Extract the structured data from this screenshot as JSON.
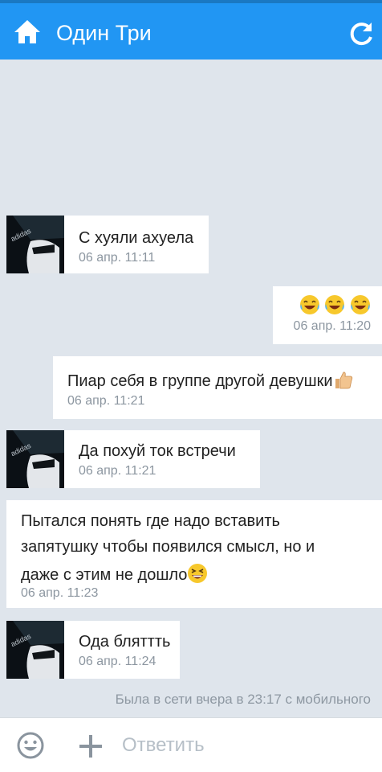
{
  "header": {
    "title": "Один Три",
    "home_icon": "home-icon",
    "refresh_icon": "refresh-icon",
    "accent": "#2196f3"
  },
  "messages": [
    {
      "text": "С хуяли ахуела",
      "time": "06 апр. 11:11"
    },
    {
      "text": "",
      "emoji": [
        "laughing-crying-emoji",
        "laughing-crying-emoji",
        "laughing-crying-emoji"
      ],
      "time": "06 апр. 11:20"
    },
    {
      "text": "Пиар себя в группе другой девушки",
      "emoji": [
        "thumbs-up-emoji"
      ],
      "time": "06 апр. 11:21"
    },
    {
      "text": "Да похуй ток встречи",
      "time": "06 апр. 11:21"
    },
    {
      "lines": [
        "Пытался понять где надо вставить",
        "запятушку чтобы появился смысл, но и",
        "даже с этим не дошло"
      ],
      "emoji": [
        "grinning-squint-emoji"
      ],
      "time": "06 апр. 11:23"
    },
    {
      "text": "Ода бляттть",
      "time": "06 апр. 11:24"
    }
  ],
  "status": "Была в сети вчера в 23:17 с мобильного",
  "composer": {
    "placeholder": "Ответить",
    "emoji_icon": "smiley-icon",
    "add_icon": "plus-icon"
  }
}
